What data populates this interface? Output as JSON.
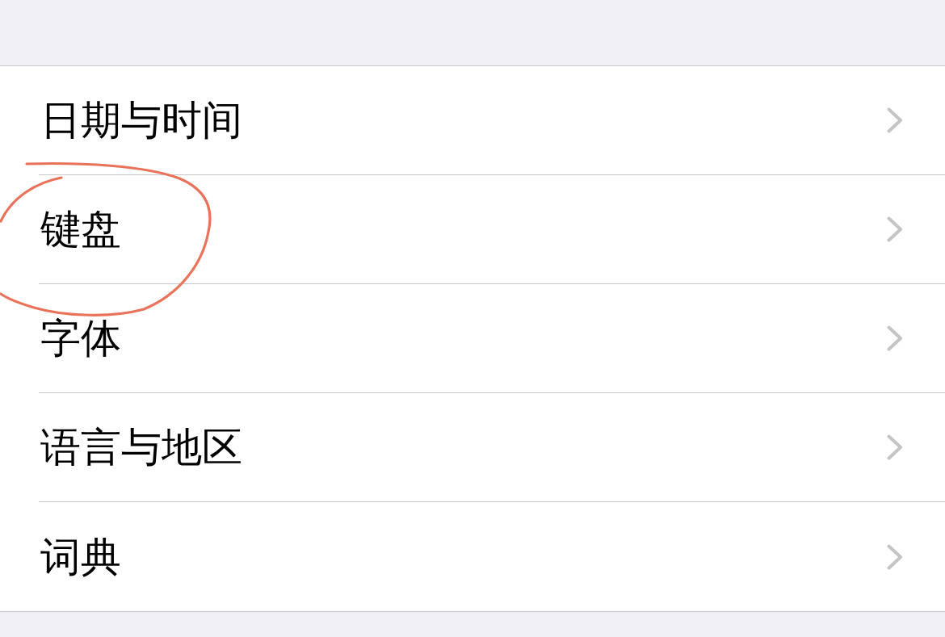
{
  "items": [
    {
      "label": "日期与时间",
      "circled": false
    },
    {
      "label": "键盘",
      "circled": true
    },
    {
      "label": "字体",
      "circled": false
    },
    {
      "label": "语言与地区",
      "circled": false
    },
    {
      "label": "词典",
      "circled": false
    }
  ]
}
